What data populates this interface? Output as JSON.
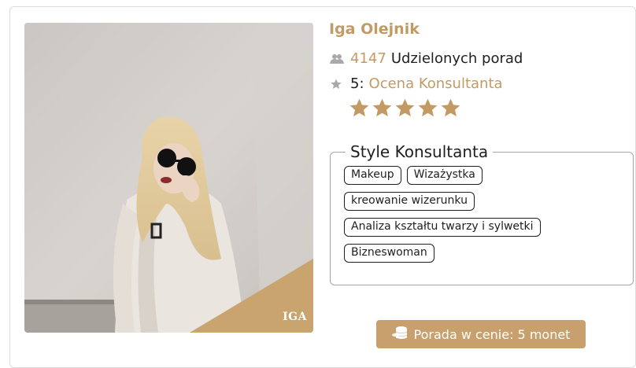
{
  "consultant": {
    "name": "Iga Olejnik",
    "photo_caption": "IGA",
    "advice_count": "4147",
    "advice_label": "Udzielonych porad",
    "rating_value": "5:",
    "rating_label": "Ocena Konsultanta",
    "stars_filled": 5,
    "stars_total": 5
  },
  "styles": {
    "legend": "Style Konsultanta",
    "tags": [
      "Makeup",
      "Wizażystka",
      "kreowanie wizerunku",
      "Analiza kształtu twarzy i sylwetki",
      "Bizneswoman"
    ]
  },
  "price_button": {
    "label": "Porada w cenie: 5 monet"
  },
  "icons": {
    "advice": "users-icon",
    "rating": "star-icon",
    "price": "coins-icon"
  },
  "colors": {
    "accent": "#c29a63",
    "button": "#c8a06d",
    "text": "#1f1f1f"
  }
}
